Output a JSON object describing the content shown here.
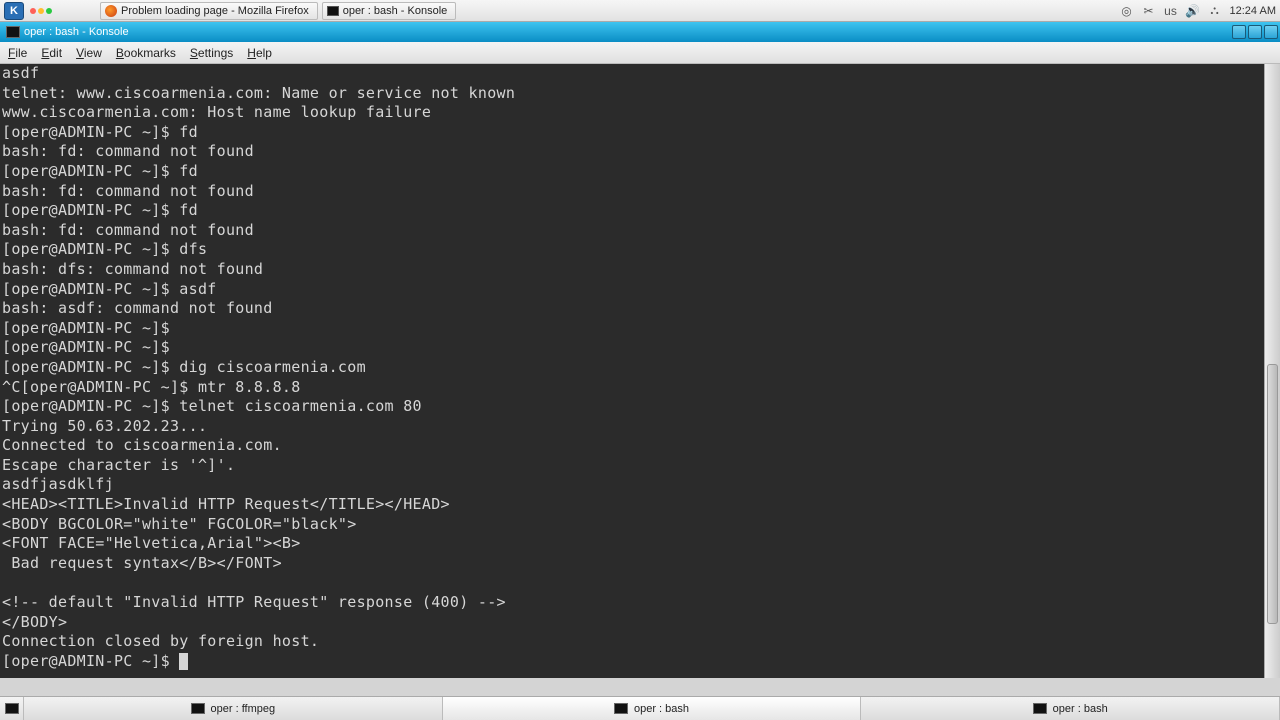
{
  "os": {
    "tasks": [
      {
        "label": "Problem loading page - Mozilla Firefox"
      },
      {
        "label": "oper : bash - Konsole"
      }
    ],
    "keyboard_layout": "us",
    "clock": "12:24 AM"
  },
  "window": {
    "title": "oper : bash - Konsole"
  },
  "menubar": [
    "File",
    "Edit",
    "View",
    "Bookmarks",
    "Settings",
    "Help"
  ],
  "terminal_lines": [
    "asdf",
    "telnet: www.ciscoarmenia.com: Name or service not known",
    "www.ciscoarmenia.com: Host name lookup failure",
    "[oper@ADMIN-PC ~]$ fd",
    "bash: fd: command not found",
    "[oper@ADMIN-PC ~]$ fd",
    "bash: fd: command not found",
    "[oper@ADMIN-PC ~]$ fd",
    "bash: fd: command not found",
    "[oper@ADMIN-PC ~]$ dfs",
    "bash: dfs: command not found",
    "[oper@ADMIN-PC ~]$ asdf",
    "bash: asdf: command not found",
    "[oper@ADMIN-PC ~]$ ",
    "[oper@ADMIN-PC ~]$ ",
    "[oper@ADMIN-PC ~]$ dig ciscoarmenia.com",
    "^C[oper@ADMIN-PC ~]$ mtr 8.8.8.8",
    "[oper@ADMIN-PC ~]$ telnet ciscoarmenia.com 80",
    "Trying 50.63.202.23...",
    "Connected to ciscoarmenia.com.",
    "Escape character is '^]'.",
    "asdfjasdklfj",
    "<HEAD><TITLE>Invalid HTTP Request</TITLE></HEAD>",
    "<BODY BGCOLOR=\"white\" FGCOLOR=\"black\">",
    "<FONT FACE=\"Helvetica,Arial\"><B>",
    " Bad request syntax</B></FONT>",
    "",
    "<!-- default \"Invalid HTTP Request\" response (400) -->",
    "</BODY>",
    "Connection closed by foreign host.",
    "[oper@ADMIN-PC ~]$ "
  ],
  "tabs": [
    {
      "label": "oper : ffmpeg",
      "active": false
    },
    {
      "label": "oper : bash",
      "active": true
    },
    {
      "label": "oper : bash",
      "active": false
    }
  ]
}
